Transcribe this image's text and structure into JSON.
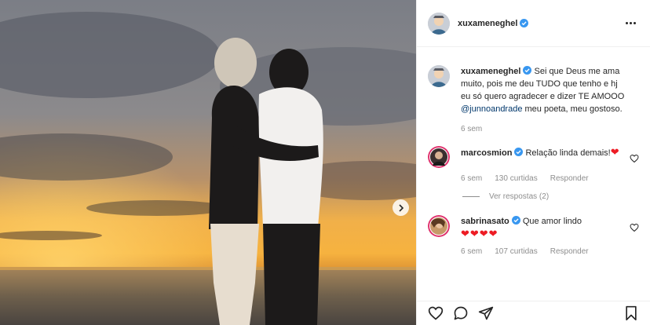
{
  "post": {
    "author": "xuxameneghel",
    "verified": true,
    "more_icon": "more-horizontal-icon",
    "caption": {
      "username": "xuxameneghel",
      "text_before": "Sei que Deus me ama muito, pois me deu TUDO que tenho e hj eu só quero agradecer e dizer TE AMOOO ",
      "mention": "@junnoandrade",
      "text_after": " meu poeta, meu gostoso.",
      "time": "6 sem"
    },
    "comments": [
      {
        "username": "marcosmion",
        "verified": true,
        "text": "Relação linda demais!",
        "emoji": "❤",
        "time": "6 sem",
        "likes": "130 curtidas",
        "reply_label": "Responder",
        "view_replies": "Ver respostas (2)"
      },
      {
        "username": "sabrinasato",
        "verified": true,
        "text": "Que amor lindo",
        "emoji": "❤❤❤❤",
        "time": "6 sem",
        "likes": "107 curtidas",
        "reply_label": "Responder"
      }
    ],
    "colors": {
      "verified": "#3897f0",
      "mention": "#00376b",
      "heart": "#ed1c24",
      "muted": "#8e8e8e"
    },
    "icons": [
      "heart-icon",
      "comment-icon",
      "share-icon",
      "bookmark-icon",
      "chevron-right-icon"
    ]
  }
}
